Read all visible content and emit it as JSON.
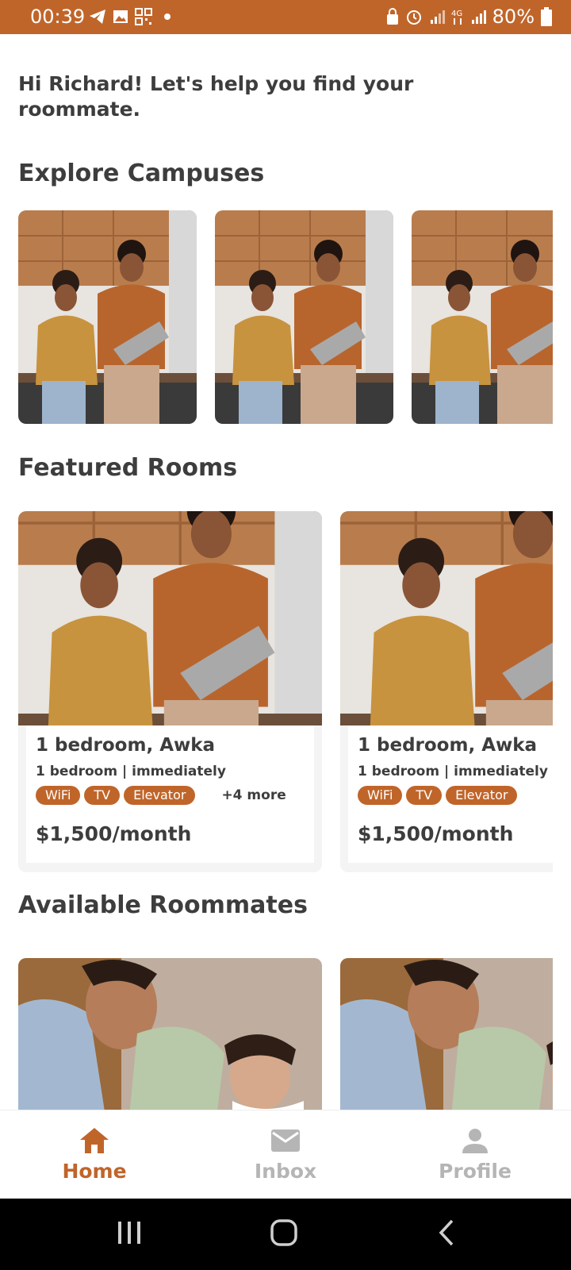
{
  "status_bar": {
    "time": "00:39",
    "battery": "80%",
    "icons_left": [
      "telegram-icon",
      "gallery-icon",
      "qr-icon",
      "dot-icon"
    ],
    "icons_right": [
      "lock-icon",
      "alarm-icon",
      "signal-icon",
      "4g-icon",
      "signal-icon-2",
      "battery-icon"
    ]
  },
  "greeting": "Hi Richard! Let's help you find your roommate.",
  "sections": {
    "campuses": "Explore Campuses",
    "rooms": "Featured Rooms",
    "roommates": "Available Roommates"
  },
  "rooms": [
    {
      "title": "1 bedroom, Awka",
      "subtitle": "1 bedroom | immediately",
      "tags": [
        "WiFi",
        "TV",
        "Elevator"
      ],
      "more": "+4 more",
      "price": "$1,500/month"
    },
    {
      "title": "1 bedroom, Awka",
      "subtitle": "1 bedroom | immediately",
      "tags": [
        "WiFi",
        "TV",
        "Elevator"
      ],
      "more": "",
      "price": "$1,500/month"
    }
  ],
  "bottom_nav": {
    "home": "Home",
    "inbox": "Inbox",
    "profile": "Profile",
    "active": "home"
  },
  "colors": {
    "accent": "#c0652a",
    "inactive": "#b5b5b5",
    "text": "#3d3d3d"
  }
}
